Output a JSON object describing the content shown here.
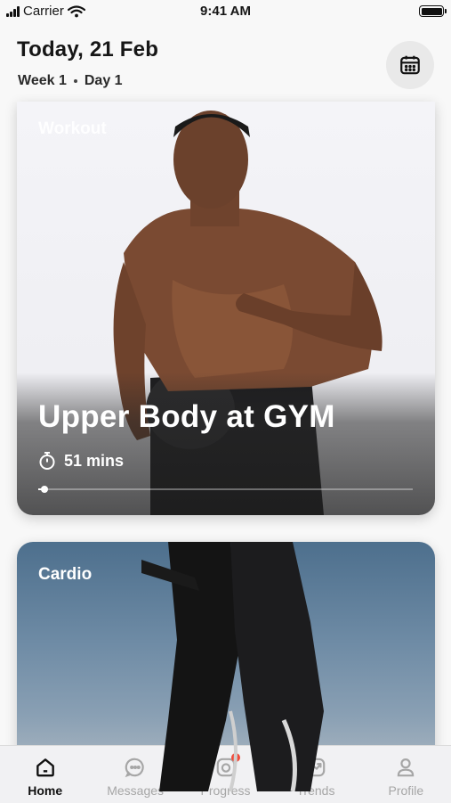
{
  "status_bar": {
    "carrier": "Carrier",
    "time": "9:41 AM"
  },
  "header": {
    "title": "Today, 21 Feb",
    "week": "Week 1",
    "day": "Day 1",
    "calendar_icon": "calendar-icon"
  },
  "cards": [
    {
      "label": "Workout",
      "title": "Upper Body at GYM",
      "duration": "51 mins",
      "progress": 0.01,
      "timer_icon": "stopwatch-icon"
    },
    {
      "label": "Cardio"
    }
  ],
  "tabbar": {
    "items": [
      {
        "label": "Home",
        "icon": "home-icon",
        "active": true
      },
      {
        "label": "Messages",
        "icon": "chat-icon",
        "active": false
      },
      {
        "label": "Progress",
        "icon": "camera-icon",
        "active": false,
        "badge": true
      },
      {
        "label": "Trends",
        "icon": "trend-chart-icon",
        "active": false
      },
      {
        "label": "Profile",
        "icon": "user-icon",
        "active": false
      }
    ]
  },
  "colors": {
    "badge": "#f04a3a",
    "active_tab": "#111111",
    "inactive_tab": "#a6a6a6"
  }
}
